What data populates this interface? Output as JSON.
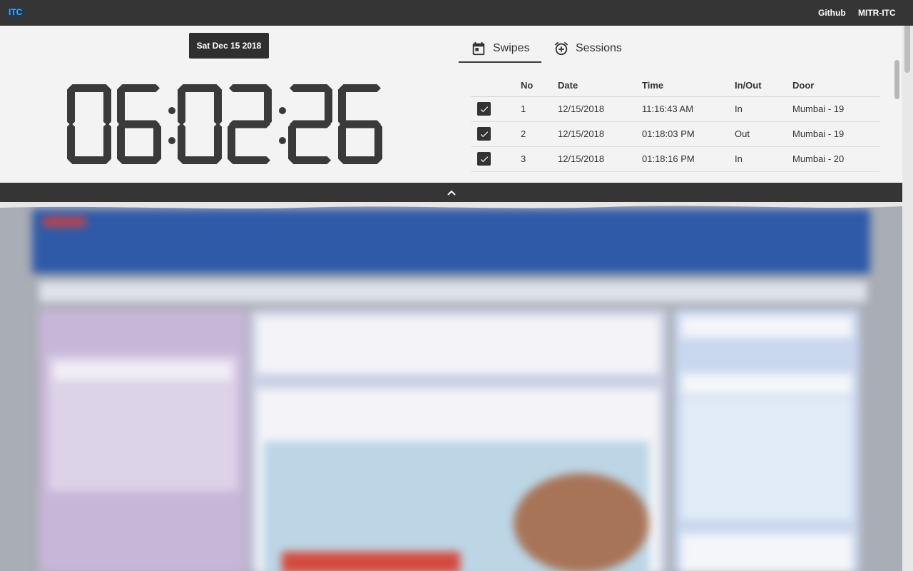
{
  "topbar": {
    "logo": "ITC",
    "links": [
      "Github",
      "MITR-ITC"
    ]
  },
  "clock_panel": {
    "date": "Sat Dec 15 2018",
    "time": "06:02:26"
  },
  "tabs": [
    {
      "label": "Swipes",
      "icon": "calendar-icon",
      "active": true
    },
    {
      "label": "Sessions",
      "icon": "alarm-add-icon",
      "active": false
    }
  ],
  "swipes_table": {
    "columns": [
      "No",
      "Date",
      "Time",
      "In/Out",
      "Door"
    ],
    "rows": [
      {
        "no": "1",
        "date": "12/15/2018",
        "time": "11:16:43 AM",
        "inout": "In",
        "door": "Mumbai - 19",
        "checked": true
      },
      {
        "no": "2",
        "date": "12/15/2018",
        "time": "01:18:03 PM",
        "inout": "Out",
        "door": "Mumbai - 19",
        "checked": true
      },
      {
        "no": "3",
        "date": "12/15/2018",
        "time": "01:18:16 PM",
        "inout": "In",
        "door": "Mumbai - 20",
        "checked": true
      }
    ]
  },
  "colors": {
    "topbar_bg": "#353535",
    "panel_bg": "#f3f3f3",
    "digit_color": "#3a3a3a",
    "logo_color": "#4aa8f0"
  },
  "collapse_icon": "chevron-up-icon"
}
